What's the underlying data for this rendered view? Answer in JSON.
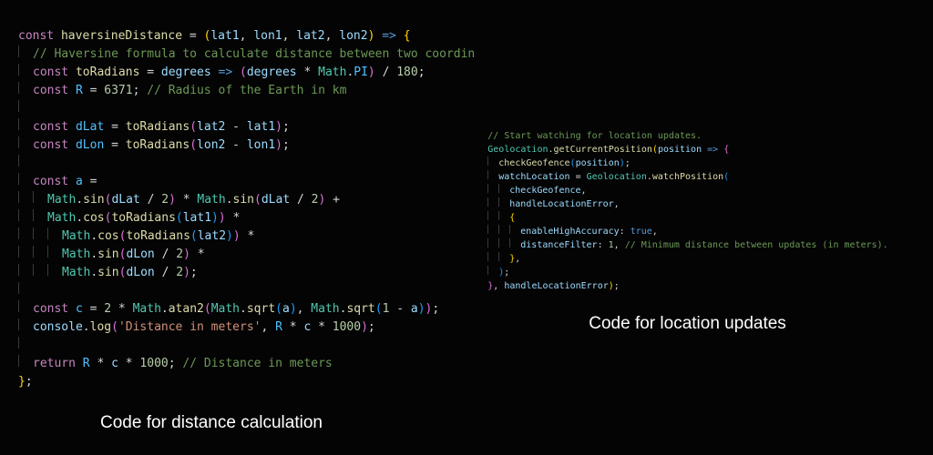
{
  "captions": {
    "left": "Code for distance calculation",
    "right": "Code for location updates"
  },
  "theme": {
    "bg": "#050405",
    "keyword": "#c586c0",
    "function": "#dcdcaa",
    "identifier": "#9cdcfe",
    "class": "#4ec9b0",
    "number": "#b5cea8",
    "string": "#ce9178",
    "comment": "#6a9955",
    "punctuation": "#d4d4d4"
  },
  "left_code": {
    "lines": [
      [
        {
          "t": "const",
          "c": "kw"
        },
        {
          "t": " ",
          "c": "pn"
        },
        {
          "t": "haversineDistance",
          "c": "fn"
        },
        {
          "t": " = ",
          "c": "pn"
        },
        {
          "t": "(",
          "c": "br1"
        },
        {
          "t": "lat1",
          "c": "prm"
        },
        {
          "t": ", ",
          "c": "pn"
        },
        {
          "t": "lon1",
          "c": "prm"
        },
        {
          "t": ", ",
          "c": "pn"
        },
        {
          "t": "lat2",
          "c": "prm"
        },
        {
          "t": ", ",
          "c": "pn"
        },
        {
          "t": "lon2",
          "c": "prm"
        },
        {
          "t": ")",
          "c": "br1"
        },
        {
          "t": " ",
          "c": "pn"
        },
        {
          "t": "=>",
          "c": "arr"
        },
        {
          "t": " ",
          "c": "pn"
        },
        {
          "t": "{",
          "c": "br1"
        }
      ],
      [
        {
          "indent": 1
        },
        {
          "t": "// Haversine formula to calculate distance between two coordin",
          "c": "cmt"
        }
      ],
      [
        {
          "indent": 1
        },
        {
          "t": "const",
          "c": "kw"
        },
        {
          "t": " ",
          "c": "pn"
        },
        {
          "t": "toRadians",
          "c": "fn"
        },
        {
          "t": " = ",
          "c": "pn"
        },
        {
          "t": "degrees",
          "c": "prm"
        },
        {
          "t": " ",
          "c": "pn"
        },
        {
          "t": "=>",
          "c": "arr"
        },
        {
          "t": " ",
          "c": "pn"
        },
        {
          "t": "(",
          "c": "br2"
        },
        {
          "t": "degrees",
          "c": "name"
        },
        {
          "t": " * ",
          "c": "op"
        },
        {
          "t": "Math",
          "c": "cls"
        },
        {
          "t": ".",
          "c": "pn"
        },
        {
          "t": "PI",
          "c": "name2"
        },
        {
          "t": ")",
          "c": "br2"
        },
        {
          "t": " / ",
          "c": "op"
        },
        {
          "t": "180",
          "c": "num"
        },
        {
          "t": ";",
          "c": "pn"
        }
      ],
      [
        {
          "indent": 1
        },
        {
          "t": "const",
          "c": "kw"
        },
        {
          "t": " ",
          "c": "pn"
        },
        {
          "t": "R",
          "c": "name2"
        },
        {
          "t": " = ",
          "c": "pn"
        },
        {
          "t": "6371",
          "c": "num"
        },
        {
          "t": "; ",
          "c": "pn"
        },
        {
          "t": "// Radius of the Earth in km",
          "c": "cmt"
        }
      ],
      [
        {
          "indent": 1,
          "blank": true
        }
      ],
      [
        {
          "indent": 1
        },
        {
          "t": "const",
          "c": "kw"
        },
        {
          "t": " ",
          "c": "pn"
        },
        {
          "t": "dLat",
          "c": "name2"
        },
        {
          "t": " = ",
          "c": "pn"
        },
        {
          "t": "toRadians",
          "c": "fn"
        },
        {
          "t": "(",
          "c": "br2"
        },
        {
          "t": "lat2",
          "c": "name"
        },
        {
          "t": " - ",
          "c": "op"
        },
        {
          "t": "lat1",
          "c": "name"
        },
        {
          "t": ")",
          "c": "br2"
        },
        {
          "t": ";",
          "c": "pn"
        }
      ],
      [
        {
          "indent": 1
        },
        {
          "t": "const",
          "c": "kw"
        },
        {
          "t": " ",
          "c": "pn"
        },
        {
          "t": "dLon",
          "c": "name2"
        },
        {
          "t": " = ",
          "c": "pn"
        },
        {
          "t": "toRadians",
          "c": "fn"
        },
        {
          "t": "(",
          "c": "br2"
        },
        {
          "t": "lon2",
          "c": "name"
        },
        {
          "t": " - ",
          "c": "op"
        },
        {
          "t": "lon1",
          "c": "name"
        },
        {
          "t": ")",
          "c": "br2"
        },
        {
          "t": ";",
          "c": "pn"
        }
      ],
      [
        {
          "indent": 1,
          "blank": true
        }
      ],
      [
        {
          "indent": 1
        },
        {
          "t": "const",
          "c": "kw"
        },
        {
          "t": " ",
          "c": "pn"
        },
        {
          "t": "a",
          "c": "name2"
        },
        {
          "t": " =",
          "c": "pn"
        }
      ],
      [
        {
          "indent": 2
        },
        {
          "t": "Math",
          "c": "cls"
        },
        {
          "t": ".",
          "c": "pn"
        },
        {
          "t": "sin",
          "c": "fn"
        },
        {
          "t": "(",
          "c": "br2"
        },
        {
          "t": "dLat",
          "c": "name"
        },
        {
          "t": " / ",
          "c": "op"
        },
        {
          "t": "2",
          "c": "num"
        },
        {
          "t": ")",
          "c": "br2"
        },
        {
          "t": " * ",
          "c": "op"
        },
        {
          "t": "Math",
          "c": "cls"
        },
        {
          "t": ".",
          "c": "pn"
        },
        {
          "t": "sin",
          "c": "fn"
        },
        {
          "t": "(",
          "c": "br2"
        },
        {
          "t": "dLat",
          "c": "name"
        },
        {
          "t": " / ",
          "c": "op"
        },
        {
          "t": "2",
          "c": "num"
        },
        {
          "t": ")",
          "c": "br2"
        },
        {
          "t": " +",
          "c": "op"
        }
      ],
      [
        {
          "indent": 2
        },
        {
          "t": "Math",
          "c": "cls"
        },
        {
          "t": ".",
          "c": "pn"
        },
        {
          "t": "cos",
          "c": "fn"
        },
        {
          "t": "(",
          "c": "br2"
        },
        {
          "t": "toRadians",
          "c": "fn"
        },
        {
          "t": "(",
          "c": "br3"
        },
        {
          "t": "lat1",
          "c": "name"
        },
        {
          "t": ")",
          "c": "br3"
        },
        {
          "t": ")",
          "c": "br2"
        },
        {
          "t": " *",
          "c": "op"
        }
      ],
      [
        {
          "indent": 3
        },
        {
          "t": "Math",
          "c": "cls"
        },
        {
          "t": ".",
          "c": "pn"
        },
        {
          "t": "cos",
          "c": "fn"
        },
        {
          "t": "(",
          "c": "br2"
        },
        {
          "t": "toRadians",
          "c": "fn"
        },
        {
          "t": "(",
          "c": "br3"
        },
        {
          "t": "lat2",
          "c": "name"
        },
        {
          "t": ")",
          "c": "br3"
        },
        {
          "t": ")",
          "c": "br2"
        },
        {
          "t": " *",
          "c": "op"
        }
      ],
      [
        {
          "indent": 3
        },
        {
          "t": "Math",
          "c": "cls"
        },
        {
          "t": ".",
          "c": "pn"
        },
        {
          "t": "sin",
          "c": "fn"
        },
        {
          "t": "(",
          "c": "br2"
        },
        {
          "t": "dLon",
          "c": "name"
        },
        {
          "t": " / ",
          "c": "op"
        },
        {
          "t": "2",
          "c": "num"
        },
        {
          "t": ")",
          "c": "br2"
        },
        {
          "t": " *",
          "c": "op"
        }
      ],
      [
        {
          "indent": 3
        },
        {
          "t": "Math",
          "c": "cls"
        },
        {
          "t": ".",
          "c": "pn"
        },
        {
          "t": "sin",
          "c": "fn"
        },
        {
          "t": "(",
          "c": "br2"
        },
        {
          "t": "dLon",
          "c": "name"
        },
        {
          "t": " / ",
          "c": "op"
        },
        {
          "t": "2",
          "c": "num"
        },
        {
          "t": ")",
          "c": "br2"
        },
        {
          "t": ";",
          "c": "pn"
        }
      ],
      [
        {
          "indent": 1,
          "blank": true
        }
      ],
      [
        {
          "indent": 1
        },
        {
          "t": "const",
          "c": "kw"
        },
        {
          "t": " ",
          "c": "pn"
        },
        {
          "t": "c",
          "c": "name2"
        },
        {
          "t": " = ",
          "c": "pn"
        },
        {
          "t": "2",
          "c": "num"
        },
        {
          "t": " * ",
          "c": "op"
        },
        {
          "t": "Math",
          "c": "cls"
        },
        {
          "t": ".",
          "c": "pn"
        },
        {
          "t": "atan2",
          "c": "fn"
        },
        {
          "t": "(",
          "c": "br2"
        },
        {
          "t": "Math",
          "c": "cls"
        },
        {
          "t": ".",
          "c": "pn"
        },
        {
          "t": "sqrt",
          "c": "fn"
        },
        {
          "t": "(",
          "c": "br3"
        },
        {
          "t": "a",
          "c": "name"
        },
        {
          "t": ")",
          "c": "br3"
        },
        {
          "t": ", ",
          "c": "pn"
        },
        {
          "t": "Math",
          "c": "cls"
        },
        {
          "t": ".",
          "c": "pn"
        },
        {
          "t": "sqrt",
          "c": "fn"
        },
        {
          "t": "(",
          "c": "br3"
        },
        {
          "t": "1",
          "c": "num"
        },
        {
          "t": " - ",
          "c": "op"
        },
        {
          "t": "a",
          "c": "name"
        },
        {
          "t": ")",
          "c": "br3"
        },
        {
          "t": ")",
          "c": "br2"
        },
        {
          "t": ";",
          "c": "pn"
        }
      ],
      [
        {
          "indent": 1
        },
        {
          "t": "console",
          "c": "name"
        },
        {
          "t": ".",
          "c": "pn"
        },
        {
          "t": "log",
          "c": "fn"
        },
        {
          "t": "(",
          "c": "br2"
        },
        {
          "t": "'Distance in meters'",
          "c": "str"
        },
        {
          "t": ", ",
          "c": "pn"
        },
        {
          "t": "R",
          "c": "name2"
        },
        {
          "t": " * ",
          "c": "op"
        },
        {
          "t": "c",
          "c": "name"
        },
        {
          "t": " * ",
          "c": "op"
        },
        {
          "t": "1000",
          "c": "num"
        },
        {
          "t": ")",
          "c": "br2"
        },
        {
          "t": ";",
          "c": "pn"
        }
      ],
      [
        {
          "indent": 1,
          "blank": true
        }
      ],
      [
        {
          "indent": 1
        },
        {
          "t": "return",
          "c": "kw"
        },
        {
          "t": " ",
          "c": "pn"
        },
        {
          "t": "R",
          "c": "name2"
        },
        {
          "t": " * ",
          "c": "op"
        },
        {
          "t": "c",
          "c": "name"
        },
        {
          "t": " * ",
          "c": "op"
        },
        {
          "t": "1000",
          "c": "num"
        },
        {
          "t": "; ",
          "c": "pn"
        },
        {
          "t": "// Distance in meters",
          "c": "cmt"
        }
      ],
      [
        {
          "t": "}",
          "c": "br1"
        },
        {
          "t": ";",
          "c": "pn"
        }
      ]
    ]
  },
  "right_code": {
    "lines": [
      [
        {
          "t": "// Start watching for location updates.",
          "c": "cmt"
        }
      ],
      [
        {
          "t": "Geolocation",
          "c": "cls"
        },
        {
          "t": ".",
          "c": "pn"
        },
        {
          "t": "getCurrentPosition",
          "c": "fn"
        },
        {
          "t": "(",
          "c": "br1"
        },
        {
          "t": "position",
          "c": "prm"
        },
        {
          "t": " ",
          "c": "pn"
        },
        {
          "t": "=>",
          "c": "arr"
        },
        {
          "t": " ",
          "c": "pn"
        },
        {
          "t": "{",
          "c": "br2"
        }
      ],
      [
        {
          "indent": 1
        },
        {
          "t": "checkGeofence",
          "c": "fn"
        },
        {
          "t": "(",
          "c": "br3"
        },
        {
          "t": "position",
          "c": "name"
        },
        {
          "t": ")",
          "c": "br3"
        },
        {
          "t": ";",
          "c": "pn"
        }
      ],
      [
        {
          "indent": 1
        },
        {
          "t": "watchLocation",
          "c": "name"
        },
        {
          "t": " = ",
          "c": "pn"
        },
        {
          "t": "Geolocation",
          "c": "cls"
        },
        {
          "t": ".",
          "c": "pn"
        },
        {
          "t": "watchPosition",
          "c": "fn"
        },
        {
          "t": "(",
          "c": "br3"
        }
      ],
      [
        {
          "indent": 2
        },
        {
          "t": "checkGeofence",
          "c": "name"
        },
        {
          "t": ",",
          "c": "pn"
        }
      ],
      [
        {
          "indent": 2
        },
        {
          "t": "handleLocationError",
          "c": "name"
        },
        {
          "t": ",",
          "c": "pn"
        }
      ],
      [
        {
          "indent": 2
        },
        {
          "t": "{",
          "c": "br1"
        }
      ],
      [
        {
          "indent": 3
        },
        {
          "t": "enableHighAccuracy",
          "c": "name"
        },
        {
          "t": ": ",
          "c": "pn"
        },
        {
          "t": "true",
          "c": "bool"
        },
        {
          "t": ",",
          "c": "pn"
        }
      ],
      [
        {
          "indent": 3
        },
        {
          "t": "distanceFilter",
          "c": "name"
        },
        {
          "t": ": ",
          "c": "pn"
        },
        {
          "t": "1",
          "c": "num"
        },
        {
          "t": ", ",
          "c": "pn"
        },
        {
          "t": "// Minimum distance between updates (in meters).",
          "c": "cmt"
        }
      ],
      [
        {
          "indent": 2
        },
        {
          "t": "}",
          "c": "br1"
        },
        {
          "t": ",",
          "c": "pn"
        }
      ],
      [
        {
          "indent": 1
        },
        {
          "t": ")",
          "c": "br3"
        },
        {
          "t": ";",
          "c": "pn"
        }
      ],
      [
        {
          "t": "}",
          "c": "br2"
        },
        {
          "t": ", ",
          "c": "pn"
        },
        {
          "t": "handleLocationError",
          "c": "name"
        },
        {
          "t": ")",
          "c": "br1"
        },
        {
          "t": ";",
          "c": "pn"
        }
      ]
    ]
  }
}
